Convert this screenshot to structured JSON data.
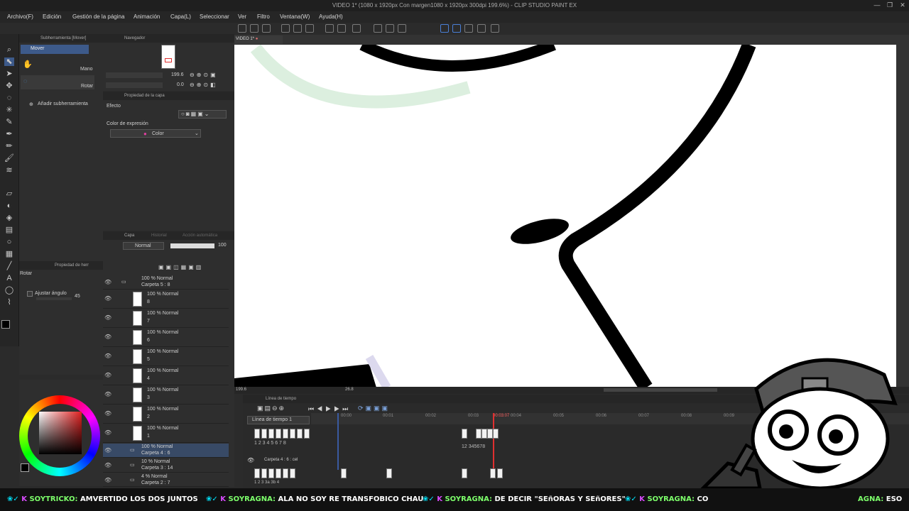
{
  "window": {
    "title": "VIDEO 1* (1080 x 1920px Con margen1080 x 1920px 300dpi 199.6%) - CLIP STUDIO PAINT EX"
  },
  "menu": [
    "Archivo(F)",
    "Edición",
    "Gestión de la página",
    "Animación",
    "Capa(L)",
    "Seleccionar",
    "Ver",
    "Filtro",
    "Ventana(W)",
    "Ayuda(H)"
  ],
  "subtool": {
    "tab": "Subherramienta [Mover]",
    "group": "Mover",
    "items": [
      "Mano",
      "Rotar"
    ],
    "add_label": "Añadir subherramienta"
  },
  "navigator": {
    "tab": "Navegador",
    "zoom": "199.6",
    "angle": "0.0"
  },
  "layer_property": {
    "tab": "Propiedad de la capa",
    "effect_label": "Efecto",
    "expression_label": "Color de expresión",
    "expression_value": "Color"
  },
  "tool_property": {
    "tab": "Propiedad de herr",
    "tool": "Rotar",
    "snap_label": "Ajustar ángulo",
    "snap_value": "45"
  },
  "layers": {
    "tabs": [
      "Capa",
      "Historial",
      "Acción automática"
    ],
    "blend": "Normal",
    "opacity": "100",
    "folder_top": {
      "line1": "100 % Normal",
      "line2": "Carpeta 5 : 8"
    },
    "rows": [
      {
        "line1": "100 % Normal",
        "line2": "8"
      },
      {
        "line1": "100 % Normal",
        "line2": "7"
      },
      {
        "line1": "100 % Normal",
        "line2": "6"
      },
      {
        "line1": "100 % Normal",
        "line2": "5"
      },
      {
        "line1": "100 % Normal",
        "line2": "4"
      },
      {
        "line1": "100 % Normal",
        "line2": "3"
      },
      {
        "line1": "100 % Normal",
        "line2": "2"
      },
      {
        "line1": "100 % Normal",
        "line2": "1"
      }
    ],
    "folders": [
      {
        "line1": "100 % Normal",
        "line2": "Carpeta 4 : 6"
      },
      {
        "line1": "10 % Normal",
        "line2": "Carpeta 3 : 14"
      },
      {
        "line1": "4 % Normal",
        "line2": "Carpeta 2 : 7"
      }
    ]
  },
  "canvas": {
    "tab": "VIDEO 1*",
    "zoom": "199.6",
    "angle": "26.8"
  },
  "timeline": {
    "tab": "Línea de tiempo",
    "name": "Línea de tiempo 1",
    "current": "00:03:07",
    "ticks": [
      "00:00",
      "00:01",
      "00:02",
      "00:03",
      "00:04",
      "00:05",
      "00:06",
      "00:07",
      "00:08",
      "00:09"
    ],
    "track1_label": "Carpeta 4 : 6 : cel",
    "cel_numbers_a": "1 2 3 4 5 6 7 8",
    "cel_numbers_b": "12  345678",
    "cel_numbers_c": "1 2 3 3a 3b 4"
  },
  "chat": [
    {
      "user": "SOYTRICKO:",
      "text": "AMVERTIDO LOS DOS JUNTOS"
    },
    {
      "user": "SOYRAGNA:",
      "text": "ALA NO SOY RE TRANSFOBICO CHAU"
    },
    {
      "user": "SOYRAGNA:",
      "text": "DE DECIR \"SEñORAS Y SEñORES\""
    },
    {
      "user": "SOYRAGNA:",
      "text": "CO"
    },
    {
      "user": "AGNA:",
      "text": "ESO"
    }
  ],
  "colors": {
    "accent": "#4a7fd6",
    "brand_green": "#7dff6b",
    "timeline_marker": "#e03030"
  }
}
